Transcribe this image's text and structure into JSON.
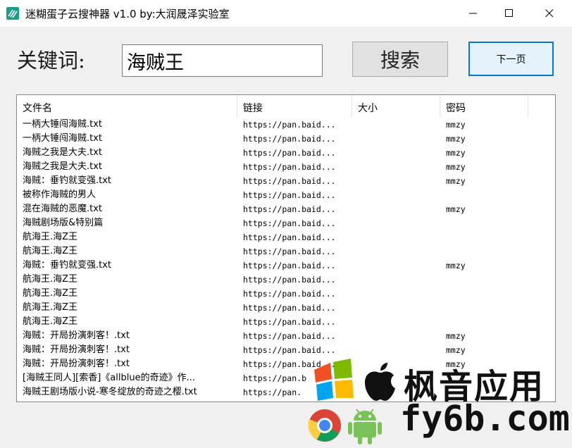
{
  "window": {
    "title": "迷糊蛋子云搜神器 v1.0  by:大润晟泽实验室",
    "icon": "app-icon"
  },
  "search": {
    "label": "关键词:",
    "value": "海贼王",
    "search_button": "搜索",
    "next_button": "下一页"
  },
  "table": {
    "columns": [
      "文件名",
      "链接",
      "大小",
      "密码"
    ],
    "rows": [
      {
        "name": "一柄大锤闯海贼.txt",
        "link": "https://pan.baid...",
        "size": "",
        "password": "mmzy"
      },
      {
        "name": "一柄大锤闯海贼.txt",
        "link": "https://pan.baid...",
        "size": "",
        "password": "mmzy"
      },
      {
        "name": "海贼之我是大夫.txt",
        "link": "https://pan.baid...",
        "size": "",
        "password": "mmzy"
      },
      {
        "name": "海贼之我是大夫.txt",
        "link": "https://pan.baid...",
        "size": "",
        "password": "mmzy"
      },
      {
        "name": "海贼：垂钓就变强.txt",
        "link": "https://pan.baid...",
        "size": "",
        "password": "mmzy"
      },
      {
        "name": "被称作海贼的男人",
        "link": "https://pan.baid...",
        "size": "",
        "password": ""
      },
      {
        "name": "混在海贼的恶魔.txt",
        "link": "https://pan.baid...",
        "size": "",
        "password": "mmzy"
      },
      {
        "name": "海贼剧场版&特别篇",
        "link": "https://pan.baid...",
        "size": "",
        "password": ""
      },
      {
        "name": "航海王.海Z王",
        "link": "https://pan.baid...",
        "size": "",
        "password": ""
      },
      {
        "name": "航海王.海Z王",
        "link": "https://pan.baid...",
        "size": "",
        "password": ""
      },
      {
        "name": "海贼：垂钓就变强.txt",
        "link": "https://pan.baid...",
        "size": "",
        "password": "mmzy"
      },
      {
        "name": "航海王.海Z王",
        "link": "https://pan.baid...",
        "size": "",
        "password": ""
      },
      {
        "name": "航海王.海Z王",
        "link": "https://pan.baid...",
        "size": "",
        "password": ""
      },
      {
        "name": "航海王.海Z王",
        "link": "https://pan.baid...",
        "size": "",
        "password": ""
      },
      {
        "name": "航海王.海Z王",
        "link": "https://pan.baid...",
        "size": "",
        "password": ""
      },
      {
        "name": "海贼：开局扮演刺客！.txt",
        "link": "https://pan.baid...",
        "size": "",
        "password": "mmzy"
      },
      {
        "name": "海贼：开局扮演刺客！.txt",
        "link": "https://pan.baid...",
        "size": "",
        "password": "mmzy"
      },
      {
        "name": "海贼：开局扮演刺客！.txt",
        "link": "https://pan.baid...",
        "size": "",
        "password": "mmzy"
      },
      {
        "name": "[海贼王同人][索香]《allblue的奇迹》作...",
        "link": "https://pan.b",
        "size": "",
        "password": ""
      },
      {
        "name": "海贼王剧场版小说-寒冬绽放的奇迹之樱.txt",
        "link": "https://pan.",
        "size": "",
        "password": ""
      }
    ]
  },
  "watermark": {
    "title": "枫音应用",
    "domain": "fy6b.com"
  },
  "colors": {
    "accent": "#0078d7",
    "border": "#828790"
  }
}
